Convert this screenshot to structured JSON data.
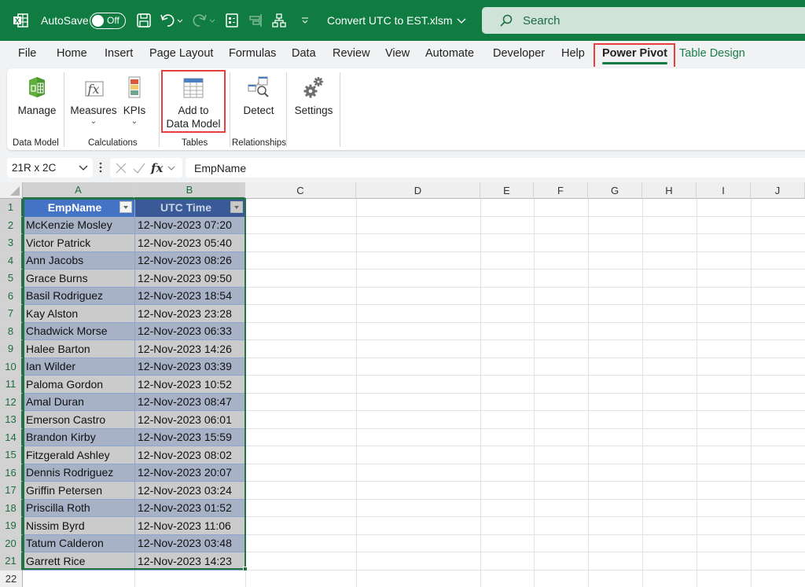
{
  "titlebar": {
    "app_icon": "excel-icon",
    "autosave_label": "AutoSave",
    "autosave_state": "Off",
    "file_name": "Convert UTC to EST.xlsm",
    "search_placeholder": "Search",
    "quick_access": [
      "save-icon",
      "undo-icon",
      "redo-icon",
      "form-icon",
      "align-icon",
      "hierarchy-icon",
      "customize-icon"
    ]
  },
  "ribbon_tabs": [
    {
      "label": "File"
    },
    {
      "label": "Home"
    },
    {
      "label": "Insert"
    },
    {
      "label": "Page Layout"
    },
    {
      "label": "Formulas"
    },
    {
      "label": "Data"
    },
    {
      "label": "Review"
    },
    {
      "label": "View"
    },
    {
      "label": "Automate"
    },
    {
      "label": "Developer"
    },
    {
      "label": "Help"
    },
    {
      "label": "Power Pivot",
      "active": true
    },
    {
      "label": "Table Design",
      "contextual": true
    }
  ],
  "ribbon": {
    "buttons": {
      "manage": "Manage",
      "measures": "Measures",
      "kpis": "KPIs",
      "add_to_line1": "Add to",
      "add_to_line2": "Data Model",
      "detect": "Detect",
      "settings": "Settings"
    },
    "groups": {
      "data_model": "Data Model",
      "calculations": "Calculations",
      "tables": "Tables",
      "relationships": "Relationships"
    },
    "chevron": "⌄"
  },
  "formula_bar": {
    "name_box": "21R x 2C",
    "fx": "fx",
    "formula": "EmpName"
  },
  "sheet": {
    "columns": [
      "A",
      "B",
      "C",
      "D",
      "E",
      "F",
      "G",
      "H",
      "I",
      "J"
    ],
    "row_numbers": [
      "1",
      "2",
      "3",
      "4",
      "5",
      "6",
      "7",
      "8",
      "9",
      "10",
      "11",
      "12",
      "13",
      "14",
      "15",
      "16",
      "17",
      "18",
      "19",
      "20",
      "21",
      "22"
    ],
    "table": {
      "headers": [
        "EmpName",
        "UTC Time"
      ],
      "rows": [
        [
          "McKenzie Mosley",
          "12-Nov-2023 07:20"
        ],
        [
          "Victor Patrick",
          "12-Nov-2023 05:40"
        ],
        [
          "Ann Jacobs",
          "12-Nov-2023 08:26"
        ],
        [
          "Grace Burns",
          "12-Nov-2023 09:50"
        ],
        [
          "Basil Rodriguez",
          "12-Nov-2023 18:54"
        ],
        [
          "Kay Alston",
          "12-Nov-2023 23:28"
        ],
        [
          "Chadwick Morse",
          "12-Nov-2023 06:33"
        ],
        [
          "Halee Barton",
          "12-Nov-2023 14:26"
        ],
        [
          "Ian Wilder",
          "12-Nov-2023 03:39"
        ],
        [
          "Paloma Gordon",
          "12-Nov-2023 10:52"
        ],
        [
          "Amal Duran",
          "12-Nov-2023 08:47"
        ],
        [
          "Emerson Castro",
          "12-Nov-2023 06:01"
        ],
        [
          "Brandon Kirby",
          "12-Nov-2023 15:59"
        ],
        [
          "Fitzgerald Ashley",
          "12-Nov-2023 08:02"
        ],
        [
          "Dennis Rodriguez",
          "12-Nov-2023 20:07"
        ],
        [
          "Griffin Petersen",
          "12-Nov-2023 03:24"
        ],
        [
          "Priscilla Roth",
          "12-Nov-2023 01:52"
        ],
        [
          "Nissim Byrd",
          "12-Nov-2023 11:06"
        ],
        [
          "Tatum Calderon",
          "12-Nov-2023 03:48"
        ],
        [
          "Garrett Rice",
          "12-Nov-2023 14:23"
        ]
      ]
    }
  },
  "colors": {
    "excel_green": "#107c41",
    "highlight_red": "#e8403f",
    "table_header": "#4472c4",
    "band_dark": "#a7b2c7",
    "band_light": "#cbcbcb"
  }
}
